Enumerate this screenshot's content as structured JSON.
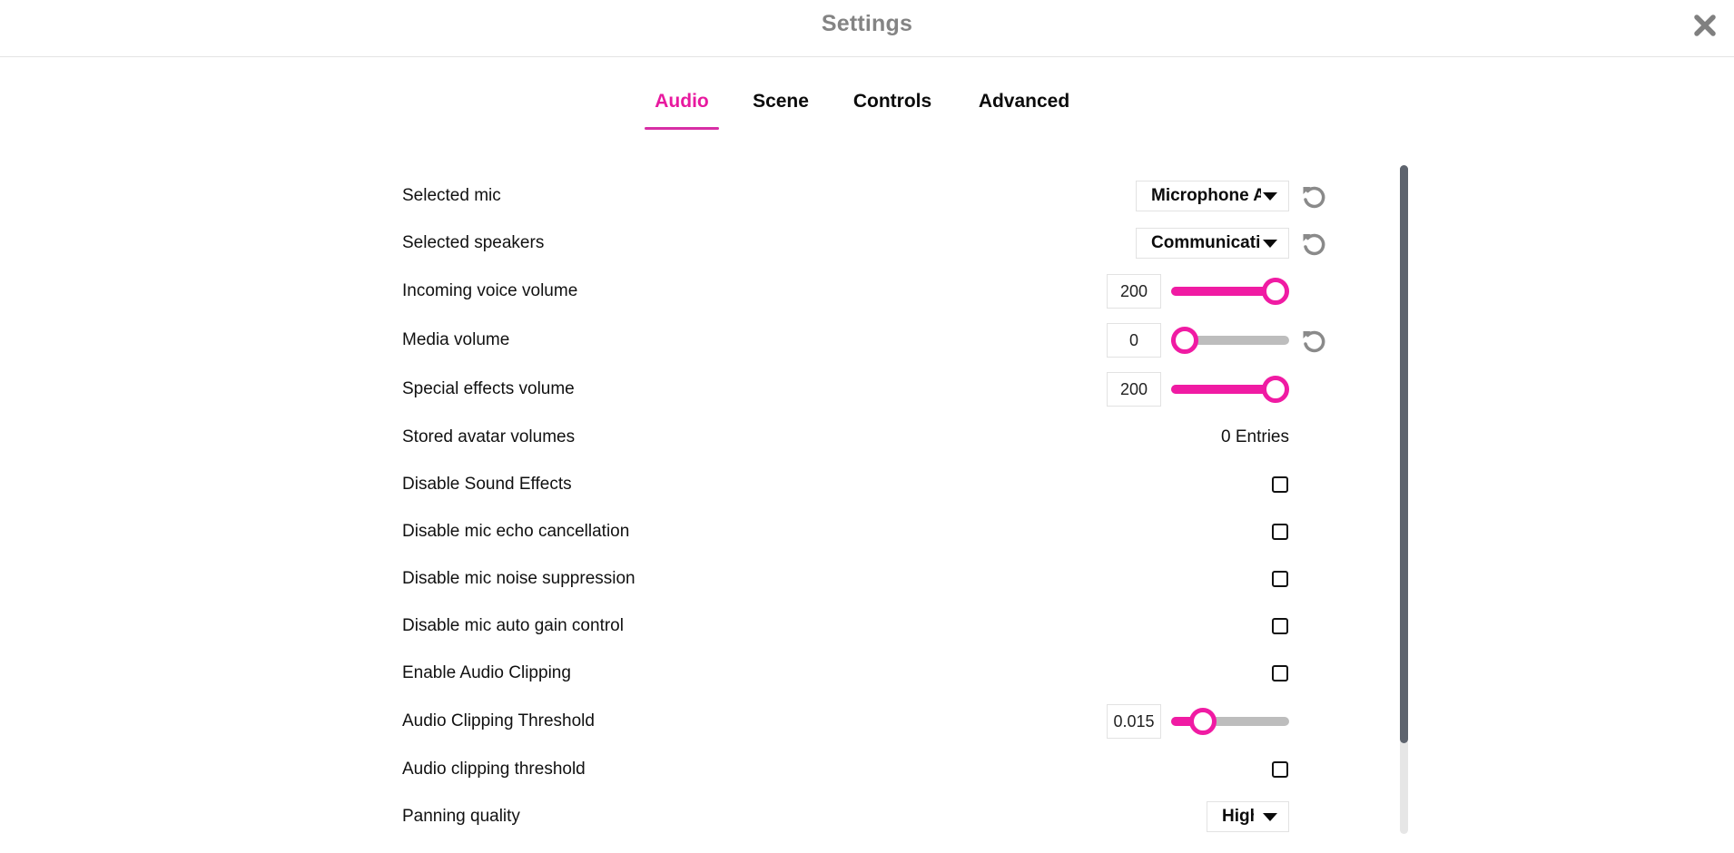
{
  "header": {
    "title": "Settings",
    "close_icon": "close-icon"
  },
  "tabs": [
    {
      "label": "Audio",
      "active": true
    },
    {
      "label": "Scene",
      "active": false
    },
    {
      "label": "Controls",
      "active": false
    },
    {
      "label": "Advanced",
      "active": false
    }
  ],
  "colors": {
    "accent": "#f01ba3",
    "tab_active": "#e8199f",
    "title_gray": "#848484",
    "scroll_thumb": "#5e646e",
    "track_gray": "#bdbdbd"
  },
  "settings": {
    "selected_mic": {
      "label": "Selected mic",
      "value": "Microphone A",
      "reset_icon": "reset-icon"
    },
    "selected_speakers": {
      "label": "Selected speakers",
      "value": "Communications",
      "reset_icon": "reset-icon"
    },
    "incoming_voice_volume": {
      "label": "Incoming voice volume",
      "value": "200",
      "fraction": 1.0
    },
    "media_volume": {
      "label": "Media volume",
      "value": "0",
      "fraction": 0.0,
      "reset_icon": "reset-icon"
    },
    "special_effects_volume": {
      "label": "Special effects volume",
      "value": "200",
      "fraction": 1.0
    },
    "stored_avatar_volumes": {
      "label": "Stored avatar volumes",
      "value": "0 Entries"
    },
    "disable_sound_effects": {
      "label": "Disable Sound Effects",
      "checked": false
    },
    "disable_echo_cancellation": {
      "label": "Disable mic echo cancellation",
      "checked": false
    },
    "disable_noise_suppression": {
      "label": "Disable mic noise suppression",
      "checked": false
    },
    "disable_auto_gain": {
      "label": "Disable mic auto gain control",
      "checked": false
    },
    "enable_audio_clipping": {
      "label": "Enable Audio Clipping",
      "checked": false
    },
    "audio_clipping_threshold": {
      "label": "Audio Clipping Threshold",
      "value": "0.015",
      "fraction": 0.2
    },
    "audio_clipping_threshold_toggle": {
      "label": "Audio clipping threshold",
      "checked": false
    },
    "panning_quality": {
      "label": "Panning quality",
      "value": "High"
    }
  }
}
